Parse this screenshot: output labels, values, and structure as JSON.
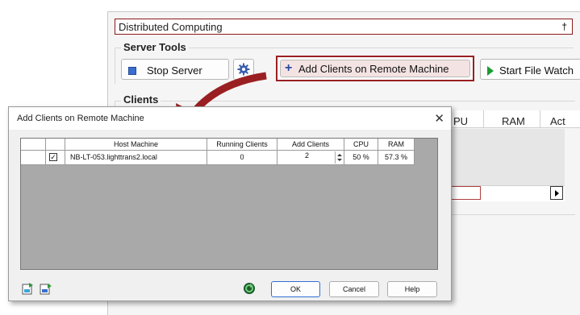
{
  "background_window": {
    "title": "Distributed Computing",
    "pin_glyph": "†",
    "server_tools_label": "Server Tools",
    "stop_server_label": "Stop Server",
    "add_clients_label": "Add Clients on Remote Machine",
    "start_file_watch_label": "Start File Watch",
    "clients_label": "Clients",
    "columns": [
      "PU",
      "RAM",
      "Act"
    ]
  },
  "dialog": {
    "title": "Add Clients on Remote Machine",
    "close_glyph": "✕",
    "table": {
      "headers": [
        "Host Machine",
        "Running Clients",
        "Add Clients",
        "CPU",
        "RAM"
      ],
      "rows": [
        {
          "checked": "✓",
          "host": "NB-LT-053.lighttrans2.local",
          "running": "0",
          "add": "2",
          "cpu": "50 %",
          "ram": "57.3 %"
        }
      ]
    },
    "buttons": {
      "ok": "OK",
      "cancel": "Cancel",
      "help": "Help"
    }
  },
  "colors": {
    "accent_red": "#9a1f22",
    "accent_blue": "#2f6fd6",
    "play_green": "#1d9b35"
  }
}
